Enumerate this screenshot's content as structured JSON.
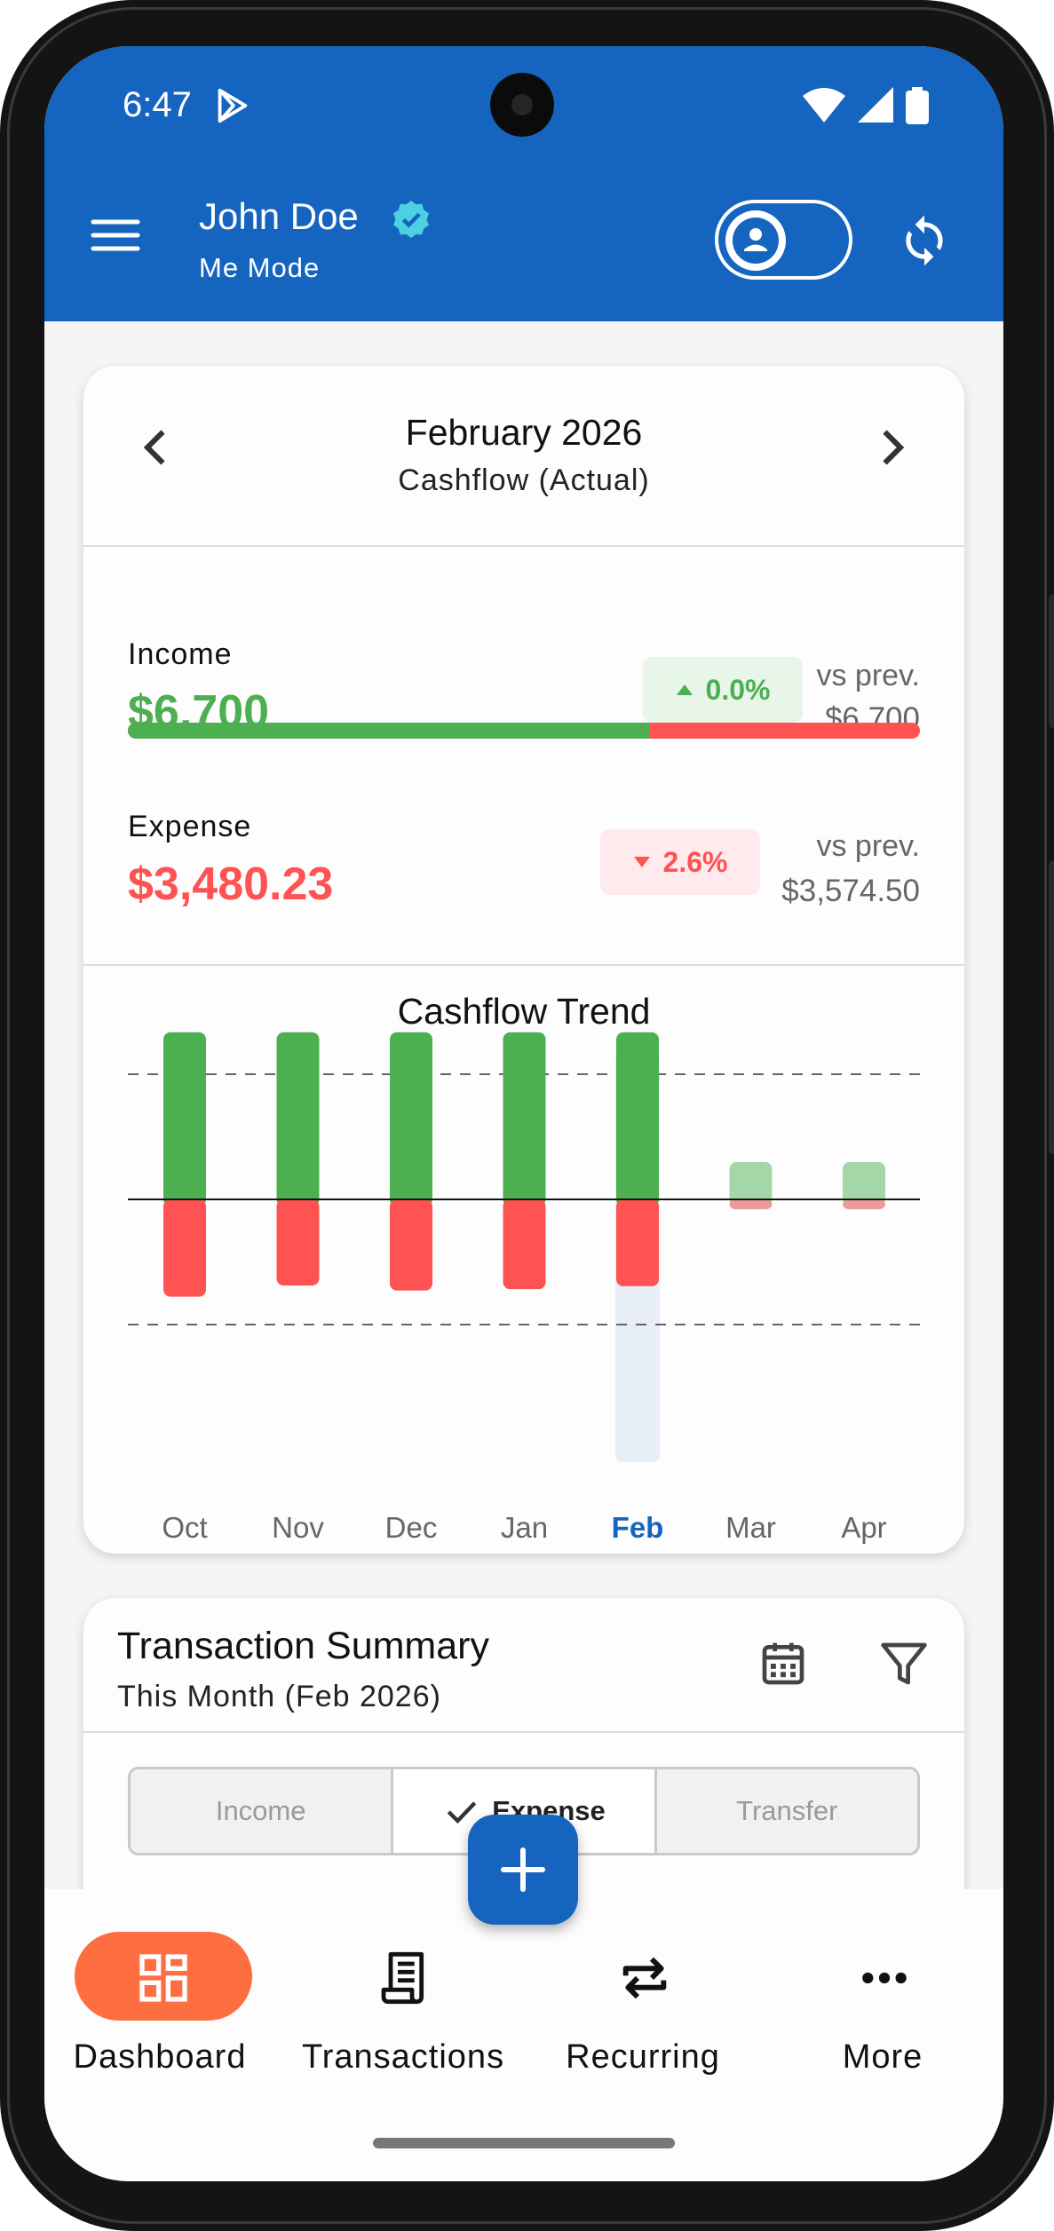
{
  "status_bar": {
    "time": "6:47"
  },
  "header": {
    "user_name": "John Doe",
    "mode": "Me Mode"
  },
  "cashflow": {
    "month": "February 2026",
    "subtitle": "Cashflow (Actual)",
    "income": {
      "label": "Income",
      "amount": "$6,700",
      "change": "0.0%",
      "vs_label": "vs prev.",
      "prev": "$6,700"
    },
    "expense": {
      "label": "Expense",
      "amount": "$3,480.23",
      "change": "2.6%",
      "vs_label": "vs prev.",
      "prev": "$3,574.50"
    },
    "income_share": 0.658
  },
  "chart_data": {
    "type": "bar",
    "title": "Cashflow Trend",
    "categories": [
      "Oct",
      "Nov",
      "Dec",
      "Jan",
      "Feb",
      "Mar",
      "Apr"
    ],
    "selected_category": "Feb",
    "series": [
      {
        "values": [
          6700,
          6700,
          6700,
          6700,
          6700,
          1500,
          1500
        ]
      },
      {
        "values": [
          3900,
          3450,
          3650,
          3600,
          3480,
          400,
          400
        ]
      }
    ],
    "reference_lines": "dashed",
    "colors": {
      "income": "#4caf50",
      "expense": "#ff5252"
    }
  },
  "transaction_summary": {
    "title": "Transaction Summary",
    "subtitle": "This Month (Feb 2026)",
    "tabs": [
      "Income",
      "Expense",
      "Transfer"
    ],
    "selected_tab": "Expense"
  },
  "bottom_nav": {
    "items": [
      "Dashboard",
      "Transactions",
      "Recurring",
      "More"
    ],
    "active": "Dashboard"
  },
  "colors": {
    "primary": "#1565c0",
    "income": "#4caf50",
    "expense": "#ff5252",
    "nav_active": "#ff6e40",
    "verified": "#4dd0e1"
  }
}
